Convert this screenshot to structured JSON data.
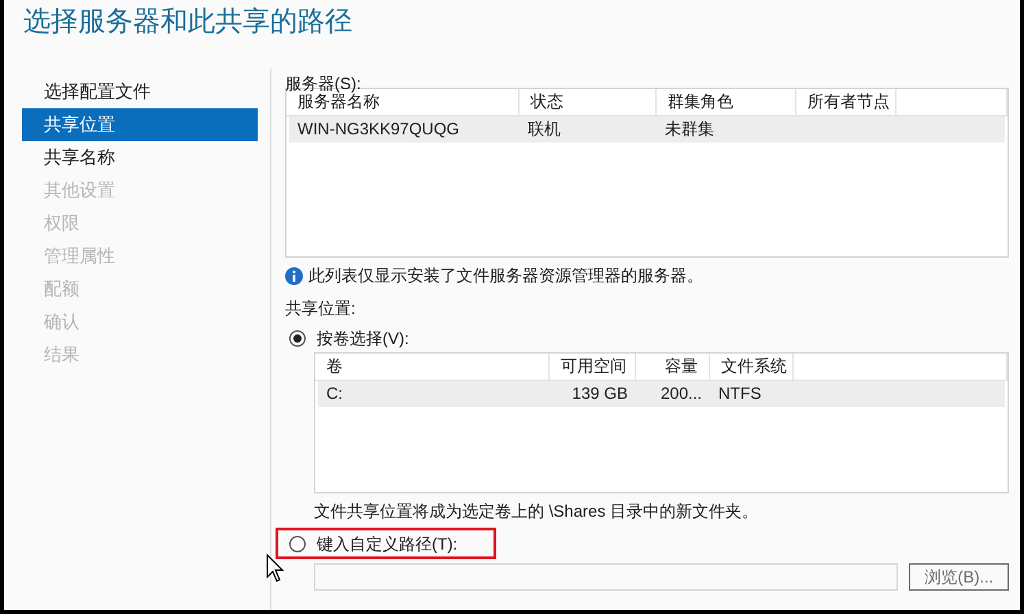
{
  "title": "选择服务器和此共享的路径",
  "sidebar": {
    "items": [
      {
        "label": "选择配置文件",
        "selected": false,
        "disabled": false
      },
      {
        "label": "共享位置",
        "selected": true,
        "disabled": false
      },
      {
        "label": "共享名称",
        "selected": false,
        "disabled": false
      },
      {
        "label": "其他设置",
        "selected": false,
        "disabled": true
      },
      {
        "label": "权限",
        "selected": false,
        "disabled": true
      },
      {
        "label": "管理属性",
        "selected": false,
        "disabled": true
      },
      {
        "label": "配额",
        "selected": false,
        "disabled": true
      },
      {
        "label": "确认",
        "selected": false,
        "disabled": true
      },
      {
        "label": "结果",
        "selected": false,
        "disabled": true
      }
    ]
  },
  "servers": {
    "label": "服务器(S):",
    "columns": [
      {
        "label": "服务器名称"
      },
      {
        "label": "状态"
      },
      {
        "label": "群集角色"
      },
      {
        "label": "所有者节点"
      }
    ],
    "rows": [
      {
        "cells": [
          "WIN-NG3KK97QUQG",
          "联机",
          "未群集",
          ""
        ],
        "selected": true
      }
    ]
  },
  "info_note": "此列表仅显示安装了文件服务器资源管理器的服务器。",
  "share_location": {
    "label": "共享位置:",
    "options": [
      {
        "label": "按卷选择(V):",
        "selected": true,
        "highlighted": false
      },
      {
        "label": "键入自定义路径(T):",
        "selected": false,
        "highlighted": true
      }
    ]
  },
  "volumes": {
    "columns": [
      {
        "label": "卷",
        "kind": "text"
      },
      {
        "label": "可用空间",
        "kind": "number"
      },
      {
        "label": "容量",
        "kind": "number"
      },
      {
        "label": "文件系统",
        "kind": "text"
      }
    ],
    "rows": [
      {
        "cells": [
          "C:",
          "139 GB",
          "200...",
          "NTFS"
        ],
        "selected": true
      }
    ]
  },
  "volume_note": "文件共享位置将成为选定卷上的 \\Shares 目录中的新文件夹。",
  "custom_path": {
    "browse_button": {
      "label": "浏览(B)...",
      "disabled": true
    }
  }
}
